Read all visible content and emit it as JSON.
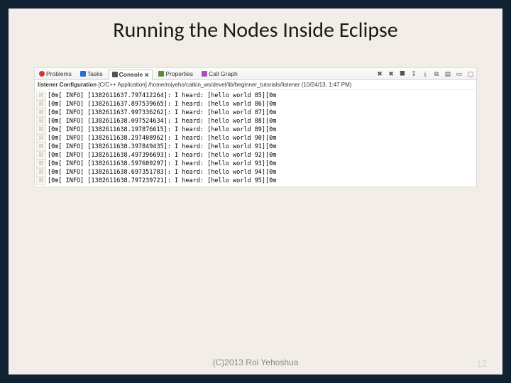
{
  "title": "Running the Nodes Inside Eclipse",
  "tabs": {
    "problems": "Problems",
    "tasks": "Tasks",
    "console": "Console",
    "properties": "Properties",
    "callgraph": "Call Graph"
  },
  "launch": {
    "config": "listener Configuration",
    "kind": "[C/C++ Application]",
    "path": "/home/roiyeho/catkin_ws/devel/lib/beginner_tutorials/listener",
    "time": "(10/24/13, 1:47 PM)"
  },
  "console_lines": [
    "[0m[ INFO] [1382611637.797412264]: I heard: [hello world 85][0m",
    "[0m[ INFO] [1382611637.897539665]: I heard: [hello world 86][0m",
    "[0m[ INFO] [1382611637.997336262]: I heard: [hello world 87][0m",
    "[0m[ INFO] [1382611638.097524634]: I heard: [hello world 88][0m",
    "[0m[ INFO] [1382611638.197876615]: I heard: [hello world 89][0m",
    "[0m[ INFO] [1382611638.297408962]: I heard: [hello world 90][0m",
    "[0m[ INFO] [1382611638.397849435]: I heard: [hello world 91][0m",
    "[0m[ INFO] [1382611638.497396693]: I heard: [hello world 92][0m",
    "[0m[ INFO] [1382611638.597609297]: I heard: [hello world 93][0m",
    "[0m[ INFO] [1382611638.697351783]: I heard: [hello world 94][0m",
    "[0m[ INFO] [1382611638.797239721]: I heard: [hello world 95][0m"
  ],
  "gutter_glyph": "☒",
  "toolbar_icons": [
    "✖",
    "✖",
    "⯀",
    "↧",
    "⤓",
    "⧉",
    "▤",
    "▭",
    "▢"
  ],
  "footer": "(C)2013 Roi Yehoshua",
  "page": "12"
}
